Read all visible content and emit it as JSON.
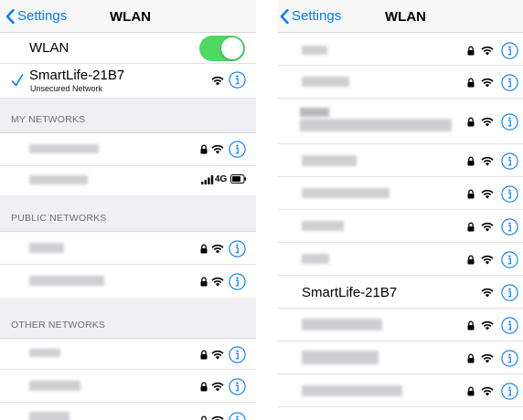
{
  "left_panel": {
    "nav": {
      "back_label": "Settings",
      "title": "WLAN"
    },
    "wlan_toggle": {
      "label": "WLAN",
      "state": "on"
    },
    "connected": {
      "name": "SmartLife-21B7",
      "status": "Unsecured Network"
    },
    "sections": {
      "my_networks": "MY NETWORKS",
      "public_networks": "PUBLIC NETWORKS",
      "other_networks": "OTHER NETWORKS"
    },
    "hotspot": {
      "cellular_label": "4G"
    }
  },
  "right_panel": {
    "nav": {
      "back_label": "Settings",
      "title": "WLAN"
    },
    "visible_network": "SmartLife-21B7"
  },
  "colors": {
    "accent": "#007aff",
    "toggle_on": "#4cd964",
    "group_bg": "#efeff4"
  },
  "icons": [
    "back-chevron-icon",
    "checkmark-icon",
    "lock-icon",
    "wifi-icon",
    "info-icon",
    "cellular-signal-icon",
    "battery-icon"
  ]
}
